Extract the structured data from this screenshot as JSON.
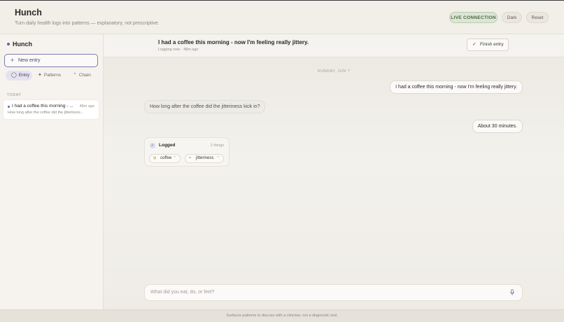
{
  "header": {
    "title": "Hunch",
    "subtitle": "Turn daily health logs into patterns — explanatory, not prescriptive.",
    "live_label": "LIVE CONNECTION",
    "dark_label": "Dark",
    "reset_label": "Reset"
  },
  "sidebar": {
    "brand": "Hunch",
    "new_entry_label": "New entry",
    "tabs": [
      {
        "label": "Entry",
        "icon": "chat-bubble-icon",
        "active": true
      },
      {
        "label": "Patterns",
        "icon": "sparkle-icon",
        "active": false
      },
      {
        "label": "Chain",
        "icon": "chain-icon",
        "active": false
      }
    ],
    "section_label": "TODAY",
    "entries": [
      {
        "title": "I had a coffee this morning - ...",
        "time": "48m ago",
        "preview": "How long after the coffee did the jitteriness..."
      }
    ]
  },
  "entry": {
    "title": "I had a coffee this morning - now I'm feeling really jittery.",
    "meta": "Logging now · 48m ago",
    "finish_label": "Finish entry"
  },
  "conversation": {
    "date_label": "SUNDAY, JUN 7",
    "messages": [
      {
        "role": "user",
        "text": "I had a coffee this morning - now I'm feeling really jittery."
      },
      {
        "role": "assistant",
        "text": "How long after the coffee did the jitteriness kick in?"
      },
      {
        "role": "user",
        "text": "About 30 minutes."
      }
    ],
    "logged": {
      "title": "Logged",
      "count": "2 things",
      "items": [
        {
          "label": "coffee",
          "icon": "fork-icon"
        },
        {
          "label": "jitteriness",
          "icon": "wave-icon"
        }
      ]
    }
  },
  "composer": {
    "placeholder": "What did you eat, do, or feel?"
  },
  "footer": {
    "text": "Surfaces patterns to discuss with a clinician; not a diagnostic tool."
  },
  "colors": {
    "accent": "#6a5fa6",
    "live_bg": "#dce6d5",
    "live_text": "#4d6a45"
  }
}
